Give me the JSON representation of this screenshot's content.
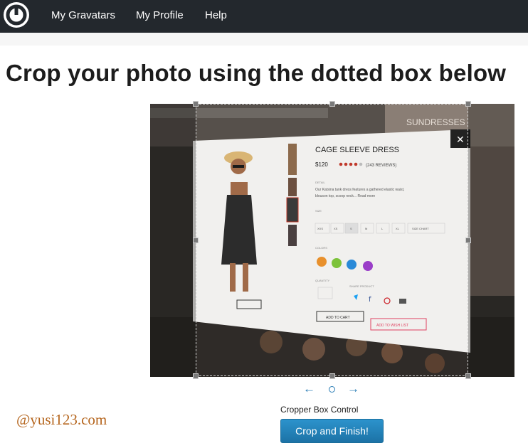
{
  "nav": {
    "items": [
      {
        "label": "My Gravatars"
      },
      {
        "label": "My Profile"
      },
      {
        "label": "Help"
      }
    ]
  },
  "page": {
    "title": "Crop your photo using the dotted box below"
  },
  "photo": {
    "product_title": "CAGE SLEEVE DRESS",
    "price": "$120",
    "reviews": "(243 REVIEWS)",
    "rating_stars": 4,
    "detail_label": "DETAIL",
    "detail_text_1": "Our Katsina tank dress features a gathered elastic waist,",
    "detail_text_2": "blouson top, scoop neck... Read more",
    "size_label": "SIZE",
    "sizes": [
      "XXS",
      "XS",
      "S",
      "M",
      "L",
      "XL",
      "SIZE CHART"
    ],
    "colors_label": "COLORS",
    "swatch_colors": [
      "#e8902c",
      "#7cc23a",
      "#2a8ad8",
      "#9a3ec8"
    ],
    "quantity_label": "QUANTITY",
    "share_label": "SHARE PRODUCT",
    "add_to_cart": "ADD TO CART",
    "add_to_wishlist": "ADD TO WISH LIST",
    "sundresses": "SUNDRESSES",
    "close_glyph": "✕"
  },
  "controls": {
    "left_arrow": "←",
    "right_arrow": "→",
    "cropper_label": "Cropper Box Control",
    "crop_button": "Crop and Finish!"
  },
  "watermark": "@yusi123.com",
  "colors": {
    "topbar": "#23282d",
    "accent": "#1f7eb8",
    "watermark": "#b5651d"
  }
}
